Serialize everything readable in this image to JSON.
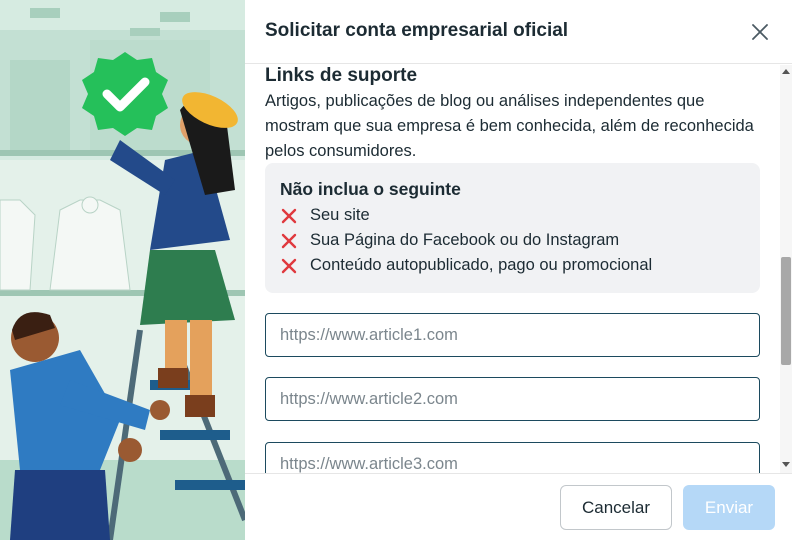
{
  "modal": {
    "title": "Solicitar conta empresarial oficial"
  },
  "support_links": {
    "title": "Links de suporte",
    "description": "Artigos, publicações de blog ou análises independentes que mostram que sua empresa é bem conhecida, além de reconhecida pelos consumidores."
  },
  "exclude": {
    "title": "Não inclua o seguinte",
    "items": [
      {
        "label": "Seu site",
        "icon": "red-x-icon"
      },
      {
        "label": "Sua Página do Facebook ou do Instagram",
        "icon": "red-x-icon"
      },
      {
        "label": "Conteúdo autopublicado, pago ou promocional",
        "icon": "red-x-icon"
      }
    ]
  },
  "inputs": [
    {
      "placeholder": "https://www.article1.com",
      "value": ""
    },
    {
      "placeholder": "https://www.article2.com",
      "value": ""
    },
    {
      "placeholder": "https://www.article3.com",
      "value": ""
    }
  ],
  "footer": {
    "cancel_label": "Cancelar",
    "send_label": "Enviar"
  },
  "colors": {
    "accent_border": "#1c4a5e",
    "disabled_button": "#b5d8f7",
    "exclude_icon": "#e0393e",
    "verified_badge": "#25c05a"
  }
}
